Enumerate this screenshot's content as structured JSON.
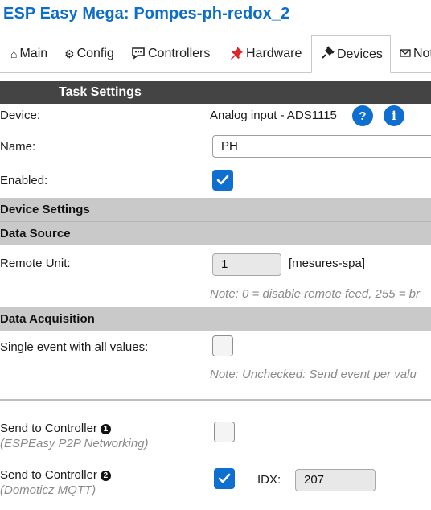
{
  "app": {
    "title": "ESP Easy Mega: Pompes-ph-redox_2"
  },
  "tabs": [
    {
      "label": "Main",
      "icon": "home-icon"
    },
    {
      "label": "Config",
      "icon": "gear-icon"
    },
    {
      "label": "Controllers",
      "icon": "chat-icon"
    },
    {
      "label": "Hardware",
      "icon": "pushpin-icon"
    },
    {
      "label": "Devices",
      "icon": "plug-icon",
      "active": true
    },
    {
      "label": "Not",
      "icon": "mail-icon"
    }
  ],
  "task_settings": {
    "header": "Task Settings",
    "device_label": "Device:",
    "device_value": "Analog input - ADS1115",
    "help_glyph": "?",
    "info_glyph": "i",
    "name_label": "Name:",
    "name_value": "PH",
    "enabled_label": "Enabled:",
    "enabled": true
  },
  "device_settings": {
    "header": "Device Settings"
  },
  "data_source": {
    "header": "Data Source",
    "remote_unit_label": "Remote Unit:",
    "remote_unit_value": "1",
    "remote_unit_name": "[mesures-spa]",
    "note": "Note: 0 = disable remote feed, 255 = br"
  },
  "data_acquisition": {
    "header": "Data Acquisition",
    "single_event_label": "Single event with all values:",
    "single_event": false,
    "note": "Note: Unchecked: Send event per valu"
  },
  "controllers": [
    {
      "label": "Send to Controller",
      "badge": "1",
      "sublabel": "(ESPEasy P2P Networking)",
      "checked": false
    },
    {
      "label": "Send to Controller",
      "badge": "2",
      "sublabel": "(Domoticz MQTT)",
      "checked": true,
      "idx_label": "IDX:",
      "idx_value": "207"
    }
  ],
  "colors": {
    "accent": "#0e6fd0",
    "title": "#0d6ec9",
    "header_dark": "#444444",
    "header_grey": "#c9c9c9"
  }
}
